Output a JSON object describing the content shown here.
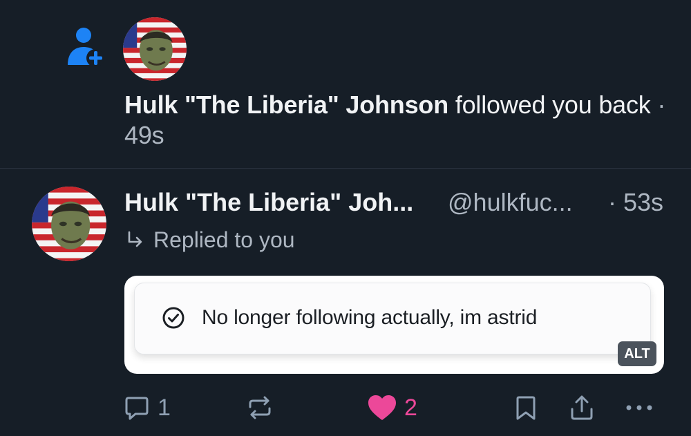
{
  "notification": {
    "icon": "person-plus-icon",
    "actor_name": "Hulk \"The Liberia\" Johnson",
    "action_text": "followed you",
    "action_text_2": "back",
    "separator": "·",
    "time": "49s"
  },
  "post": {
    "author": "Hulk \"The Liberia\" Joh...",
    "handle": "@hulkfuc...",
    "time": "· 53s",
    "reply_label": "Replied to you",
    "embed": {
      "text": "No longer following actually, im astrid",
      "alt_badge": "ALT"
    },
    "actions": {
      "reply_count": "1",
      "like_count": "2"
    }
  },
  "colors": {
    "background": "#161e27",
    "accent_blue": "#1d83f5",
    "like_pink": "#ec4899",
    "muted": "#8fa0b3"
  }
}
